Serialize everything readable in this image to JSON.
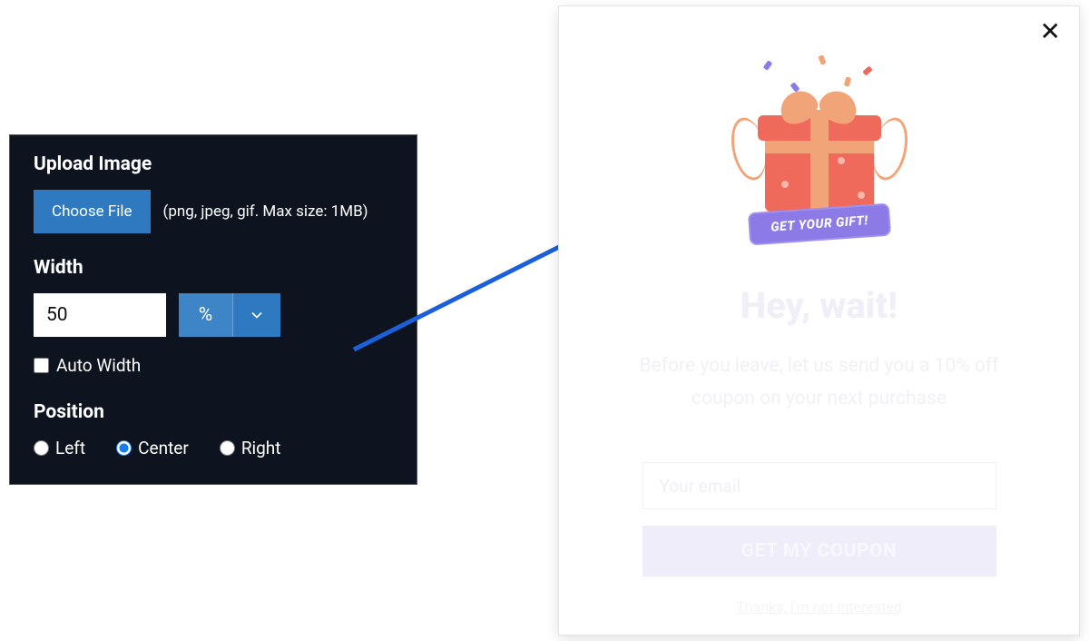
{
  "settings": {
    "upload_title": "Upload Image",
    "choose_file_label": "Choose File",
    "file_hint": "(png, jpeg, gif. Max size: 1MB)",
    "width_title": "Width",
    "width_value": "50",
    "width_unit": "%",
    "auto_width_label": "Auto Width",
    "auto_width_checked": false,
    "position_title": "Position",
    "position_options": {
      "left": "Left",
      "center": "Center",
      "right": "Right"
    },
    "position_selected": "center"
  },
  "popup": {
    "badge": "GET YOUR GIFT!",
    "headline": "Hey, wait!",
    "subtext": "Before you leave, let us send you a 10% off coupon on your next purchase",
    "email_placeholder": "Your email",
    "cta_label": "GET MY COUPON",
    "optout_label": "Thanks, I'm not interested"
  }
}
